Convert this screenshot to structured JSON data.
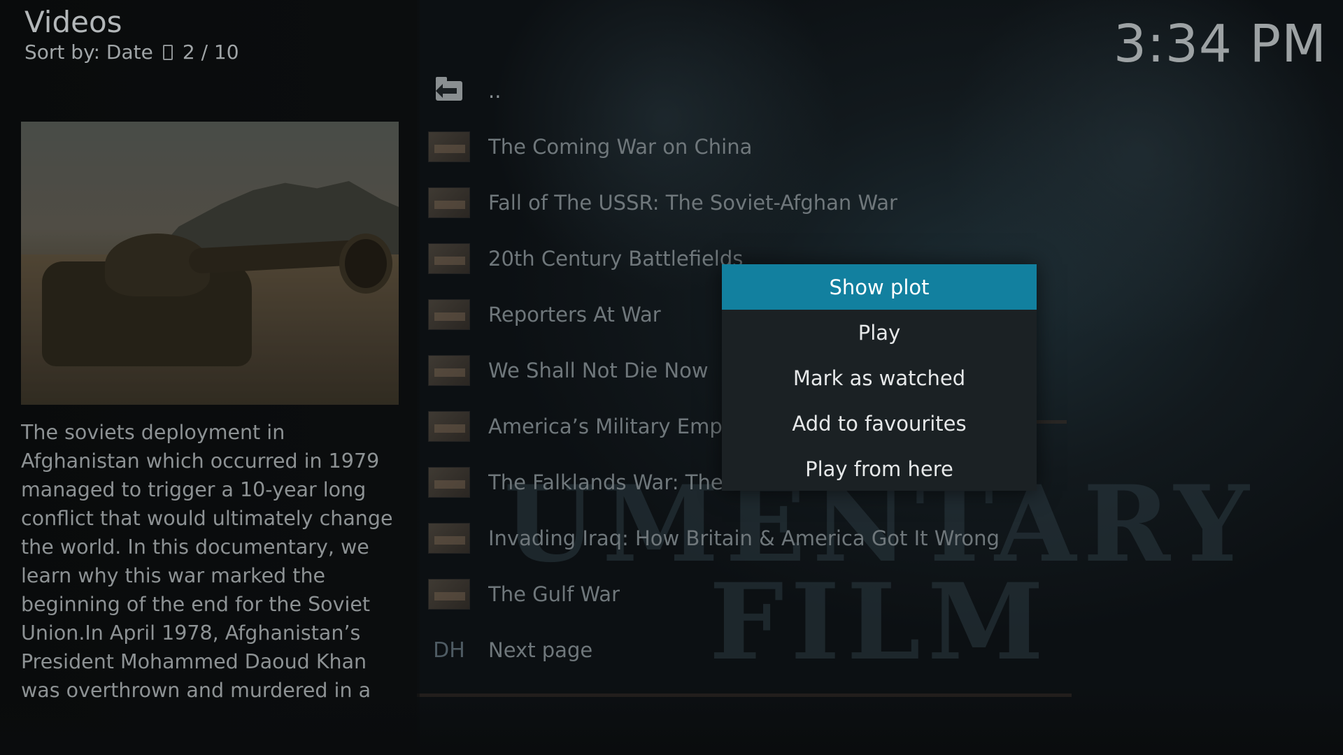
{
  "header": {
    "title": "Videos",
    "sort_label": "Sort by: Date",
    "position": "2 / 10"
  },
  "clock": "3:34 PM",
  "info": {
    "plot": "The soviets deployment in Afghanistan which occurred in 1979 managed to trigger a 10-year long conflict that would ultimately change the world. In this documentary, we learn why this war marked the beginning of the end for the Soviet Union.In April 1978, Afghanistan’s President Mohammed Daoud Khan was overthrown and murdered in a coup d’état led by"
  },
  "background": {
    "watermark_line1": "UMENTARY",
    "watermark_line2": "FILM"
  },
  "list": {
    "items": [
      {
        "label": "..",
        "icon": "folder-back-icon"
      },
      {
        "label": "The Coming War on China",
        "icon": "thumbnail"
      },
      {
        "label": "Fall of The USSR: The Soviet-Afghan War",
        "icon": "thumbnail"
      },
      {
        "label": "20th Century Battlefields",
        "icon": "thumbnail"
      },
      {
        "label": "Reporters At War",
        "icon": "thumbnail"
      },
      {
        "label": "We Shall Not Die Now",
        "icon": "thumbnail"
      },
      {
        "label": "America’s Military Empire",
        "icon": "thumbnail"
      },
      {
        "label": "The Falklands War: The U",
        "icon": "thumbnail"
      },
      {
        "label": "Invading Iraq: How Britain & America Got It Wrong",
        "icon": "thumbnail"
      },
      {
        "label": "The Gulf War",
        "icon": "thumbnail"
      },
      {
        "label": "Next page",
        "icon": "DH"
      }
    ]
  },
  "context_menu": {
    "items": [
      {
        "label": "Show plot",
        "focused": true
      },
      {
        "label": "Play"
      },
      {
        "label": "Mark as watched"
      },
      {
        "label": "Add to favourites"
      },
      {
        "label": "Play from here"
      }
    ]
  },
  "colors": {
    "accent": "#12809f",
    "menu_bg": "#1b2124"
  }
}
